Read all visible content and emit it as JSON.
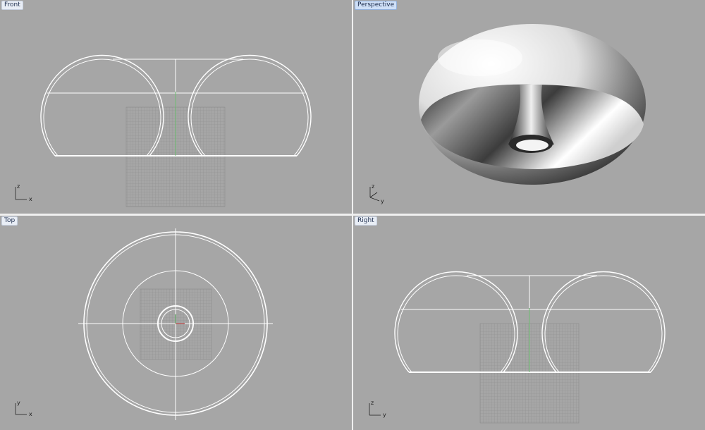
{
  "viewports": {
    "front": {
      "title": "Front",
      "axis_vertical": "z",
      "axis_horizontal": "x"
    },
    "perspective": {
      "title": "Perspective",
      "axis_vertical": "z",
      "axis_horizontal": "y"
    },
    "top": {
      "title": "Top",
      "axis_vertical": "y",
      "axis_horizontal": "x"
    },
    "right": {
      "title": "Right",
      "axis_vertical": "z",
      "axis_horizontal": "y"
    }
  },
  "colors": {
    "viewport_bg": "#a6a6a6",
    "curve": "#ffffff",
    "grid": "#8a8a8a",
    "active_label": "#cfe0f7"
  }
}
